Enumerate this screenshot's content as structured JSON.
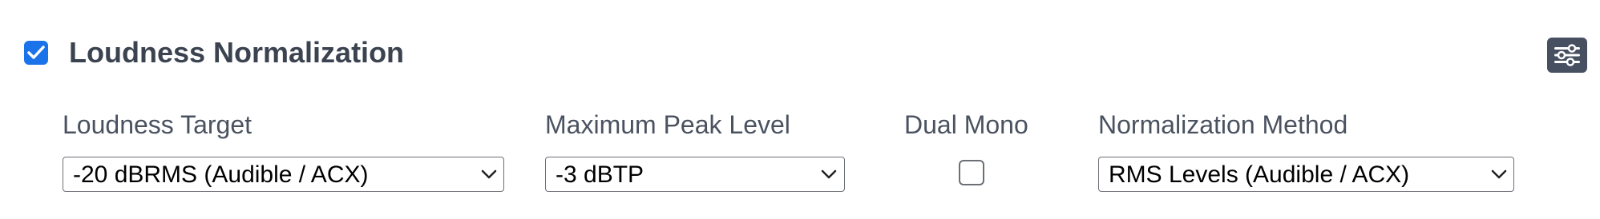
{
  "section": {
    "title": "Loudness Normalization",
    "enabled": true,
    "accent_color": "#1a73e8",
    "checkbox_icon": "checkmark-icon",
    "settings_icon": "sliders-icon",
    "settings_button_color": "#475061"
  },
  "fields": {
    "loudness_target": {
      "label": "Loudness Target",
      "value": "-20 dBRMS (Audible / ACX)"
    },
    "max_peak": {
      "label": "Maximum Peak Level",
      "value": "-3 dBTP"
    },
    "dual_mono": {
      "label": "Dual Mono",
      "checked": false
    },
    "method": {
      "label": "Normalization Method",
      "value": "RMS Levels (Audible / ACX)"
    }
  }
}
